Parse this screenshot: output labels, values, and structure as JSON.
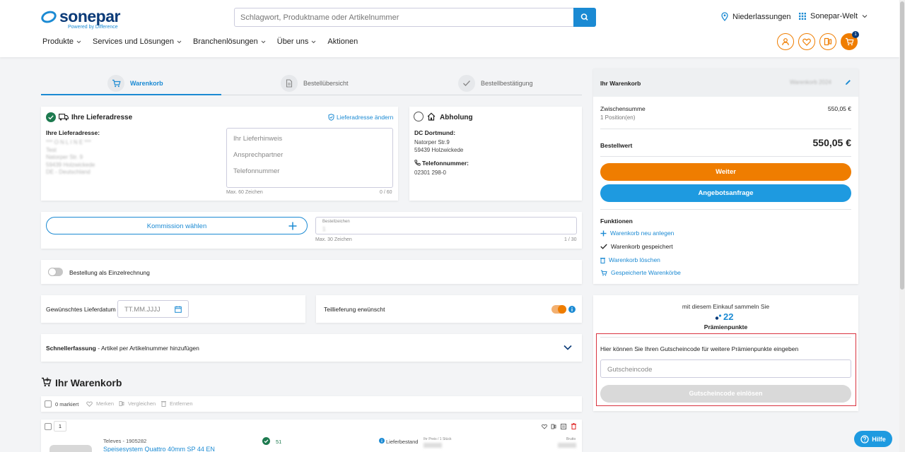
{
  "header": {
    "logo_text": "sonepar",
    "logo_sub": "Powered by Difference",
    "search_placeholder": "Schlagwort, Produktname oder Artikelnummer",
    "branches": "Niederlassungen",
    "world": "Sonepar-Welt",
    "cart_count": "1",
    "nav": [
      "Produkte",
      "Services und Lösungen",
      "Branchenlösungen",
      "Über uns",
      "Aktionen"
    ]
  },
  "steps": [
    "Warenkorb",
    "Bestellübersicht",
    "Bestellbestätigung"
  ],
  "delivery": {
    "title": "Ihre Lieferadresse",
    "change_link": "Lieferadresse ändern",
    "address_label": "Ihre Lieferadresse:",
    "address_lines": [
      "*** O N L I N E ***",
      "Test",
      "Natorper Str. 9",
      "59439 Holzwickede",
      "DE - Deutschland"
    ],
    "hint_placeholder": "Ihr Lieferhinweis",
    "contact_placeholder": "Ansprechpartner",
    "phone_placeholder": "Telefonnummer",
    "max_chars": "Max. 60 Zeichen",
    "char_count": "0 / 60"
  },
  "pickup": {
    "title": "Abholung",
    "name": "DC Dortmund:",
    "street": "Natorper Str.9",
    "city": "59439 Holzwickede",
    "phone_label": "Telefonnummer:",
    "phone": "02301 298-0"
  },
  "commission": {
    "button": "Kommission wählen",
    "order_ref_label": "Bestellzeichen",
    "order_ref_value": "1",
    "max_chars": "Max. 30 Zeichen",
    "char_count": "1 / 30"
  },
  "single_invoice": "Bestellung als Einzelrechnung",
  "delivery_date": {
    "label": "Gewünschtes Lieferdatum",
    "placeholder": "TT.MM.JJJJ"
  },
  "partial_delivery": "Teillieferung erwünscht",
  "quick_entry": {
    "bold": "Schnellerfassung",
    "rest": " - Artikel per Artikelnummer hinzufügen"
  },
  "cart": {
    "title": "Ihr Warenkorb",
    "marked": "0 markiert",
    "remember": "Merken",
    "compare": "Vergleichen",
    "remove": "Entfernen",
    "item_qty": "1",
    "item_brand": "Televes - 1905282",
    "item_name": "Speisesystem Quattro 40mm SP 44 EN",
    "item_stock": "51",
    "item_stock_label": "Lieferbestand",
    "item_price_label": "Ihr Preis / 1 Stück",
    "item_gross_label": "Brutto"
  },
  "summary": {
    "title": "Ihr Warenkorb",
    "cart_name": "Warenkorb 2024",
    "subtotal_label": "Zwischensumme",
    "subtotal_value": "550,05 €",
    "positions": "1 Position(en)",
    "order_value_label": "Bestellwert",
    "order_value": "550,05 €",
    "continue": "Weiter",
    "quote": "Angebotsanfrage",
    "functions_title": "Funktionen",
    "functions": [
      "Warenkorb neu anlegen",
      "Warenkorb gespeichert",
      "Warenkorb löschen",
      "Gespeicherte Warenkörbe"
    ]
  },
  "points": {
    "intro": "mit diesem Einkauf sammeln Sie",
    "value": "22",
    "label": "Prämienpunkte",
    "voucher_text": "Hier können Sie Ihren Gutscheincode für weitere Prämienpunkte eingeben",
    "voucher_placeholder": "Gutscheincode",
    "redeem": "Gutscheincode einlösen"
  },
  "help": "Hilfe",
  "colors": {
    "orange": "#ef7d00",
    "blue": "#1b8ad3",
    "navy": "#0a3a78",
    "green": "#1d7a4f",
    "red": "#e02b2b"
  }
}
